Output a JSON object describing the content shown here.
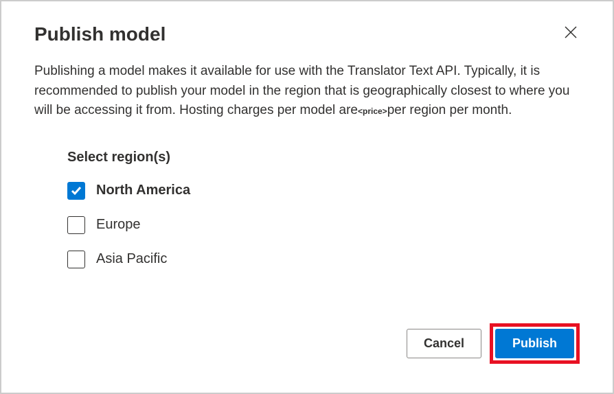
{
  "dialog": {
    "title": "Publish model",
    "description_part1": "Publishing a model makes it available for use with the Translator Text API. Typically, it is recommended to publish your model in the region that is geographically closest to where you will be accessing it from. Hosting charges per model are",
    "price_placeholder": "<price>",
    "description_part2": "per region per month."
  },
  "region_section": {
    "label": "Select region(s)",
    "options": [
      {
        "label": "North America",
        "checked": true
      },
      {
        "label": "Europe",
        "checked": false
      },
      {
        "label": "Asia Pacific",
        "checked": false
      }
    ]
  },
  "buttons": {
    "cancel": "Cancel",
    "publish": "Publish"
  }
}
